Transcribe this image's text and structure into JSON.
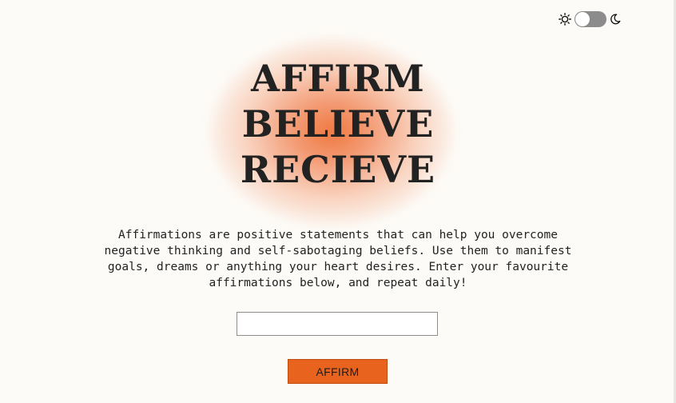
{
  "theme_toggle": {
    "light_icon": "sun-icon",
    "dark_icon": "moon-icon",
    "mode": "light"
  },
  "hero": {
    "lines": [
      "AFFIRM",
      "BELIEVE",
      "RECIEVE"
    ]
  },
  "intro": {
    "text": "Affirmations are positive statements that can help you overcome negative thinking and self-sabotaging beliefs. Use them to manifest goals, dreams or anything your heart desires. Enter your favourite affirmations below, and repeat daily!"
  },
  "affirmation_input": {
    "value": "",
    "placeholder": ""
  },
  "affirm_button": {
    "label": "AFFIRM"
  },
  "colors": {
    "background": "#fdfbf7",
    "accent": "#e8631e",
    "glow": "#ee6e32",
    "text": "#222222",
    "toggle_track": "#8c8c8c"
  }
}
